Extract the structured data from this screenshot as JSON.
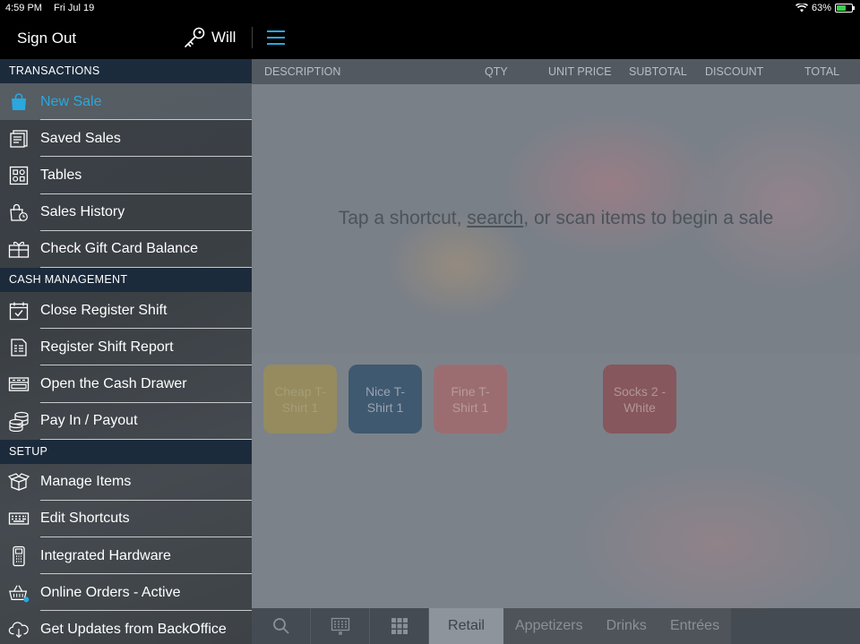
{
  "status": {
    "time": "4:59 PM",
    "date": "Fri Jul 19",
    "battery": "63%",
    "battery_level": 0.63
  },
  "nav": {
    "sign_out": "Sign Out",
    "user": "Will"
  },
  "sections": [
    {
      "title": "TRANSACTIONS",
      "items": [
        {
          "label": "New Sale",
          "icon": "shopping-bag-icon",
          "active": true
        },
        {
          "label": "Saved Sales",
          "icon": "saved-sales-icon"
        },
        {
          "label": "Tables",
          "icon": "tables-icon"
        },
        {
          "label": "Sales History",
          "icon": "sales-history-icon"
        },
        {
          "label": "Check Gift Card Balance",
          "icon": "gift-card-icon"
        }
      ]
    },
    {
      "title": "CASH MANAGEMENT",
      "items": [
        {
          "label": "Close Register Shift",
          "icon": "calendar-check-icon"
        },
        {
          "label": "Register Shift Report",
          "icon": "report-icon"
        },
        {
          "label": "Open the Cash Drawer",
          "icon": "cash-drawer-icon"
        },
        {
          "label": "Pay In / Payout",
          "icon": "coins-icon"
        }
      ]
    },
    {
      "title": "SETUP",
      "items": [
        {
          "label": "Manage Items",
          "icon": "box-icon"
        },
        {
          "label": "Edit Shortcuts",
          "icon": "keyboard-icon"
        },
        {
          "label": "Integrated Hardware",
          "icon": "card-terminal-icon"
        },
        {
          "label": "Online Orders - Active",
          "icon": "basket-icon"
        },
        {
          "label": "Get Updates from BackOffice",
          "icon": "cloud-download-icon"
        }
      ]
    }
  ],
  "table_header": {
    "description": "DESCRIPTION",
    "qty": "QTY",
    "unit_price": "UNIT PRICE",
    "subtotal": "SUBTOTAL",
    "discount": "DISCOUNT",
    "total": "TOTAL"
  },
  "empty_message": {
    "prefix": "Tap a shortcut, ",
    "link": "search",
    "suffix": ", or scan items to begin a sale"
  },
  "shortcuts": [
    {
      "label": "Cheap T-Shirt 1"
    },
    {
      "label": "Nice T-Shirt 1"
    },
    {
      "label": "Fine T-Shirt 1"
    },
    {
      "label": "Socks 2 - White"
    }
  ],
  "bottom_tabs": {
    "retail": "Retail",
    "appetizers": "Appetizers",
    "drinks": "Drinks",
    "entrees": "Entrées"
  },
  "colors": {
    "accent": "#29a8e0",
    "section_header": "#1c2b3c"
  }
}
